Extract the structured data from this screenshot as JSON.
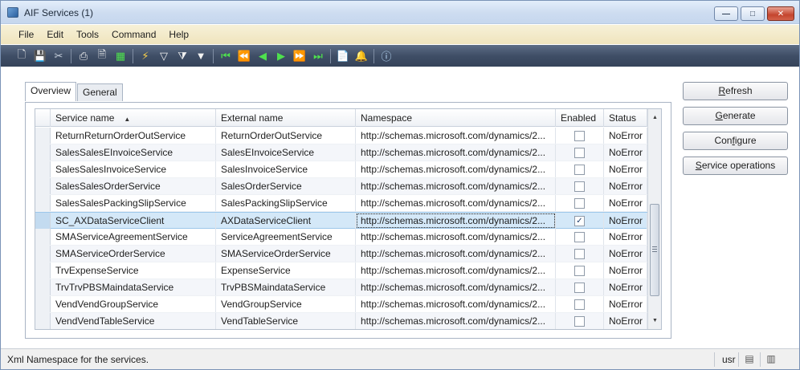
{
  "window": {
    "title": "AIF Services (1)",
    "controls": {
      "minimize": "—",
      "maximize": "□",
      "close": "✕"
    }
  },
  "menu": [
    "File",
    "Edit",
    "Tools",
    "Command",
    "Help"
  ],
  "toolbar": {
    "groups": [
      [
        {
          "name": "new-icon",
          "glyph": "🗋",
          "tone": "white"
        },
        {
          "name": "save-icon",
          "glyph": "💾",
          "tone": "white"
        },
        {
          "name": "delete-icon",
          "glyph": "✂",
          "tone": "gray"
        }
      ],
      [
        {
          "name": "print-icon",
          "glyph": "⎙",
          "tone": "white"
        },
        {
          "name": "print-preview-icon",
          "glyph": "🗎",
          "tone": "white"
        },
        {
          "name": "export-excel-icon",
          "glyph": "▦",
          "tone": "green"
        }
      ],
      [
        {
          "name": "filter-by-selection-icon",
          "glyph": "⚡",
          "tone": "yellow"
        },
        {
          "name": "filter-by-grid-icon",
          "glyph": "▽",
          "tone": "white"
        },
        {
          "name": "advanced-filter-icon",
          "glyph": "⧩",
          "tone": "white"
        },
        {
          "name": "remove-filter-icon",
          "glyph": "▼",
          "tone": "white"
        }
      ],
      [
        {
          "name": "first-record-icon",
          "glyph": "⏮",
          "tone": "green"
        },
        {
          "name": "previous-page-icon",
          "glyph": "⏪",
          "tone": "green"
        },
        {
          "name": "previous-record-icon",
          "glyph": "◀",
          "tone": "green"
        },
        {
          "name": "next-record-icon",
          "glyph": "▶",
          "tone": "green"
        },
        {
          "name": "next-page-icon",
          "glyph": "⏩",
          "tone": "green"
        },
        {
          "name": "last-record-icon",
          "glyph": "⏭",
          "tone": "green"
        }
      ],
      [
        {
          "name": "document-handling-icon",
          "glyph": "📄",
          "tone": "white"
        },
        {
          "name": "alert-icon",
          "glyph": "🔔",
          "tone": "yellow"
        }
      ],
      [
        {
          "name": "help-icon",
          "glyph": "ⓘ",
          "tone": "blue"
        }
      ]
    ]
  },
  "tabs": [
    "Overview",
    "General"
  ],
  "grid": {
    "columns": {
      "service_name": "Service name",
      "external_name": "External name",
      "namespace": "Namespace",
      "enabled": "Enabled",
      "status": "Status"
    },
    "rows": [
      {
        "service_name": "ReturnReturnOrderOutService",
        "external_name": "ReturnOrderOutService",
        "namespace": "http://schemas.microsoft.com/dynamics/2...",
        "enabled": false,
        "status": "NoError"
      },
      {
        "service_name": "SalesSalesEInvoiceService",
        "external_name": "SalesEInvoiceService",
        "namespace": "http://schemas.microsoft.com/dynamics/2...",
        "enabled": false,
        "status": "NoError"
      },
      {
        "service_name": "SalesSalesInvoiceService",
        "external_name": "SalesInvoiceService",
        "namespace": "http://schemas.microsoft.com/dynamics/2...",
        "enabled": false,
        "status": "NoError"
      },
      {
        "service_name": "SalesSalesOrderService",
        "external_name": "SalesOrderService",
        "namespace": "http://schemas.microsoft.com/dynamics/2...",
        "enabled": false,
        "status": "NoError"
      },
      {
        "service_name": "SalesSalesPackingSlipService",
        "external_name": "SalesPackingSlipService",
        "namespace": "http://schemas.microsoft.com/dynamics/2...",
        "enabled": false,
        "status": "NoError"
      },
      {
        "service_name": "SC_AXDataServiceClient",
        "external_name": "AXDataServiceClient",
        "namespace": "http://schemas.microsoft.com/dynamics/2...",
        "enabled": true,
        "status": "NoError",
        "selected": true
      },
      {
        "service_name": "SMAServiceAgreementService",
        "external_name": "ServiceAgreementService",
        "namespace": "http://schemas.microsoft.com/dynamics/2...",
        "enabled": false,
        "status": "NoError"
      },
      {
        "service_name": "SMAServiceOrderService",
        "external_name": "SMAServiceOrderService",
        "namespace": "http://schemas.microsoft.com/dynamics/2...",
        "enabled": false,
        "status": "NoError"
      },
      {
        "service_name": "TrvExpenseService",
        "external_name": "ExpenseService",
        "namespace": "http://schemas.microsoft.com/dynamics/2...",
        "enabled": false,
        "status": "NoError"
      },
      {
        "service_name": "TrvTrvPBSMaindataService",
        "external_name": "TrvPBSMaindataService",
        "namespace": "http://schemas.microsoft.com/dynamics/2...",
        "enabled": false,
        "status": "NoError"
      },
      {
        "service_name": "VendVendGroupService",
        "external_name": "VendGroupService",
        "namespace": "http://schemas.microsoft.com/dynamics/2...",
        "enabled": false,
        "status": "NoError"
      },
      {
        "service_name": "VendVendTableService",
        "external_name": "VendTableService",
        "namespace": "http://schemas.microsoft.com/dynamics/2...",
        "enabled": false,
        "status": "NoError"
      }
    ]
  },
  "buttons": {
    "refresh": {
      "prefix": "",
      "underline": "R",
      "rest": "efresh"
    },
    "generate": {
      "prefix": "",
      "underline": "G",
      "rest": "enerate"
    },
    "configure": {
      "prefix": "Con",
      "underline": "f",
      "rest": "igure"
    },
    "service_operations": {
      "prefix": "",
      "underline": "S",
      "rest": "ervice operations"
    }
  },
  "statusbar": {
    "message": "Xml Namespace for the services.",
    "user": "usr"
  },
  "colors": {
    "selected_row": "#d4e8f8",
    "toolbar_bg": "#3f4e66",
    "menubar_bg": "#efe4bd"
  }
}
